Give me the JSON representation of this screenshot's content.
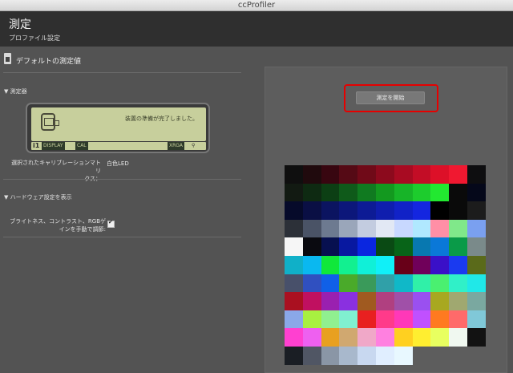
{
  "window": {
    "title": "ccProfiler"
  },
  "header": {
    "title": "測定",
    "subtitle": "プロファイル設定"
  },
  "section": {
    "title": "デフォルトの測定値"
  },
  "device": {
    "disclosure": "▼ 測定器",
    "lcd_message": "装置の準備が完了しました。",
    "bar_i1": "i1",
    "bar_display": "DISPLAY",
    "bar_cal": "CAL",
    "bar_xrga": "XRGA",
    "bar_icon": "⚲"
  },
  "calibration": {
    "label": "選択されたキャリブレーションマトリ\nクス：",
    "value": "白色LED"
  },
  "hardware": {
    "disclosure": "▼ ハードウェア設定を表示",
    "rgb_label_line1": "ブライトネス、コントラスト、RGBゲ",
    "rgb_label_line2": "インを手動で調節:",
    "rgb_checked": true
  },
  "actions": {
    "start_label": "測定を開始"
  },
  "colors": {
    "accent_outline": "#e60000",
    "patches": [
      [
        "#0f0f0f",
        "#200a0d",
        "#380610",
        "#550a15",
        "#700a18",
        "#8c0a1d",
        "#a80b22",
        "#c30d26",
        "#dd1028",
        "#f01830",
        "#0e0e10"
      ],
      [
        "#121a12",
        "#0e2a12",
        "#0c3f14",
        "#0f5a1a",
        "#107a20",
        "#13991f",
        "#17b428",
        "#1dcc2d",
        "#22e830",
        "#0a0a0a",
        "#05081a"
      ],
      [
        "#060a2a",
        "#0a0f44",
        "#0b1460",
        "#0c177a",
        "#0d1b95",
        "#0f1eae",
        "#1122c7",
        "#1426e0",
        "#000000",
        "#0a0a0a",
        "#1c1c1c"
      ],
      [
        "#2c3038",
        "#4a5366",
        "#6d7a90",
        "#9aa6ba",
        "#c3cce0",
        "#e2e8f4",
        "#c8d8ff",
        "#b0e8ff",
        "#ff8fa6",
        "#80e88a",
        "#7aa0f0"
      ],
      [
        "#f6f6f6",
        "#0a0a10",
        "#071050",
        "#0818a0",
        "#0a26e0",
        "#0a4a14",
        "#086418",
        "#0878b0",
        "#0a78d8",
        "#0a9a48",
        "#7a8a8a"
      ],
      [
        "#10b0c8",
        "#0ab8f0",
        "#10e83a",
        "#12f090",
        "#10f0d8",
        "#10f0f8",
        "#680018",
        "#70005a",
        "#3a10c8",
        "#1a3af0",
        "#5a6a1a"
      ],
      [
        "#48506a",
        "#3050c0",
        "#1060e8",
        "#4aaa2a",
        "#3a9a5a",
        "#30a0a8",
        "#10b8c8",
        "#30f0a8",
        "#4af070",
        "#30f0c8",
        "#20e8e8"
      ],
      [
        "#aa1020",
        "#c01060",
        "#9a20b0",
        "#8a30e0",
        "#a05a20",
        "#b04080",
        "#a050a8",
        "#9a50f0",
        "#a8a820",
        "#a0a870",
        "#7aa8a0"
      ],
      [
        "#8aa8e8",
        "#a8f040",
        "#90f090",
        "#80f0d0",
        "#e82020",
        "#ff3a8a",
        "#ff38b8",
        "#c050ff",
        "#ff7a20",
        "#ff6a6a",
        "#80c8d8"
      ],
      [
        "#ff40d0",
        "#ee60f0",
        "#e8a020",
        "#d0a870",
        "#f0a8c8",
        "#ff80e0",
        "#ffd020",
        "#ffee30",
        "#e8ff60",
        "#f0f8f0",
        "#121212"
      ],
      [
        "#1a1e24",
        "#505664",
        "#8a96a6",
        "#a8b8cc",
        "#c8d8f0",
        "#e0eeff",
        "#e8f8ff",
        "",
        "",
        "",
        ""
      ]
    ]
  }
}
